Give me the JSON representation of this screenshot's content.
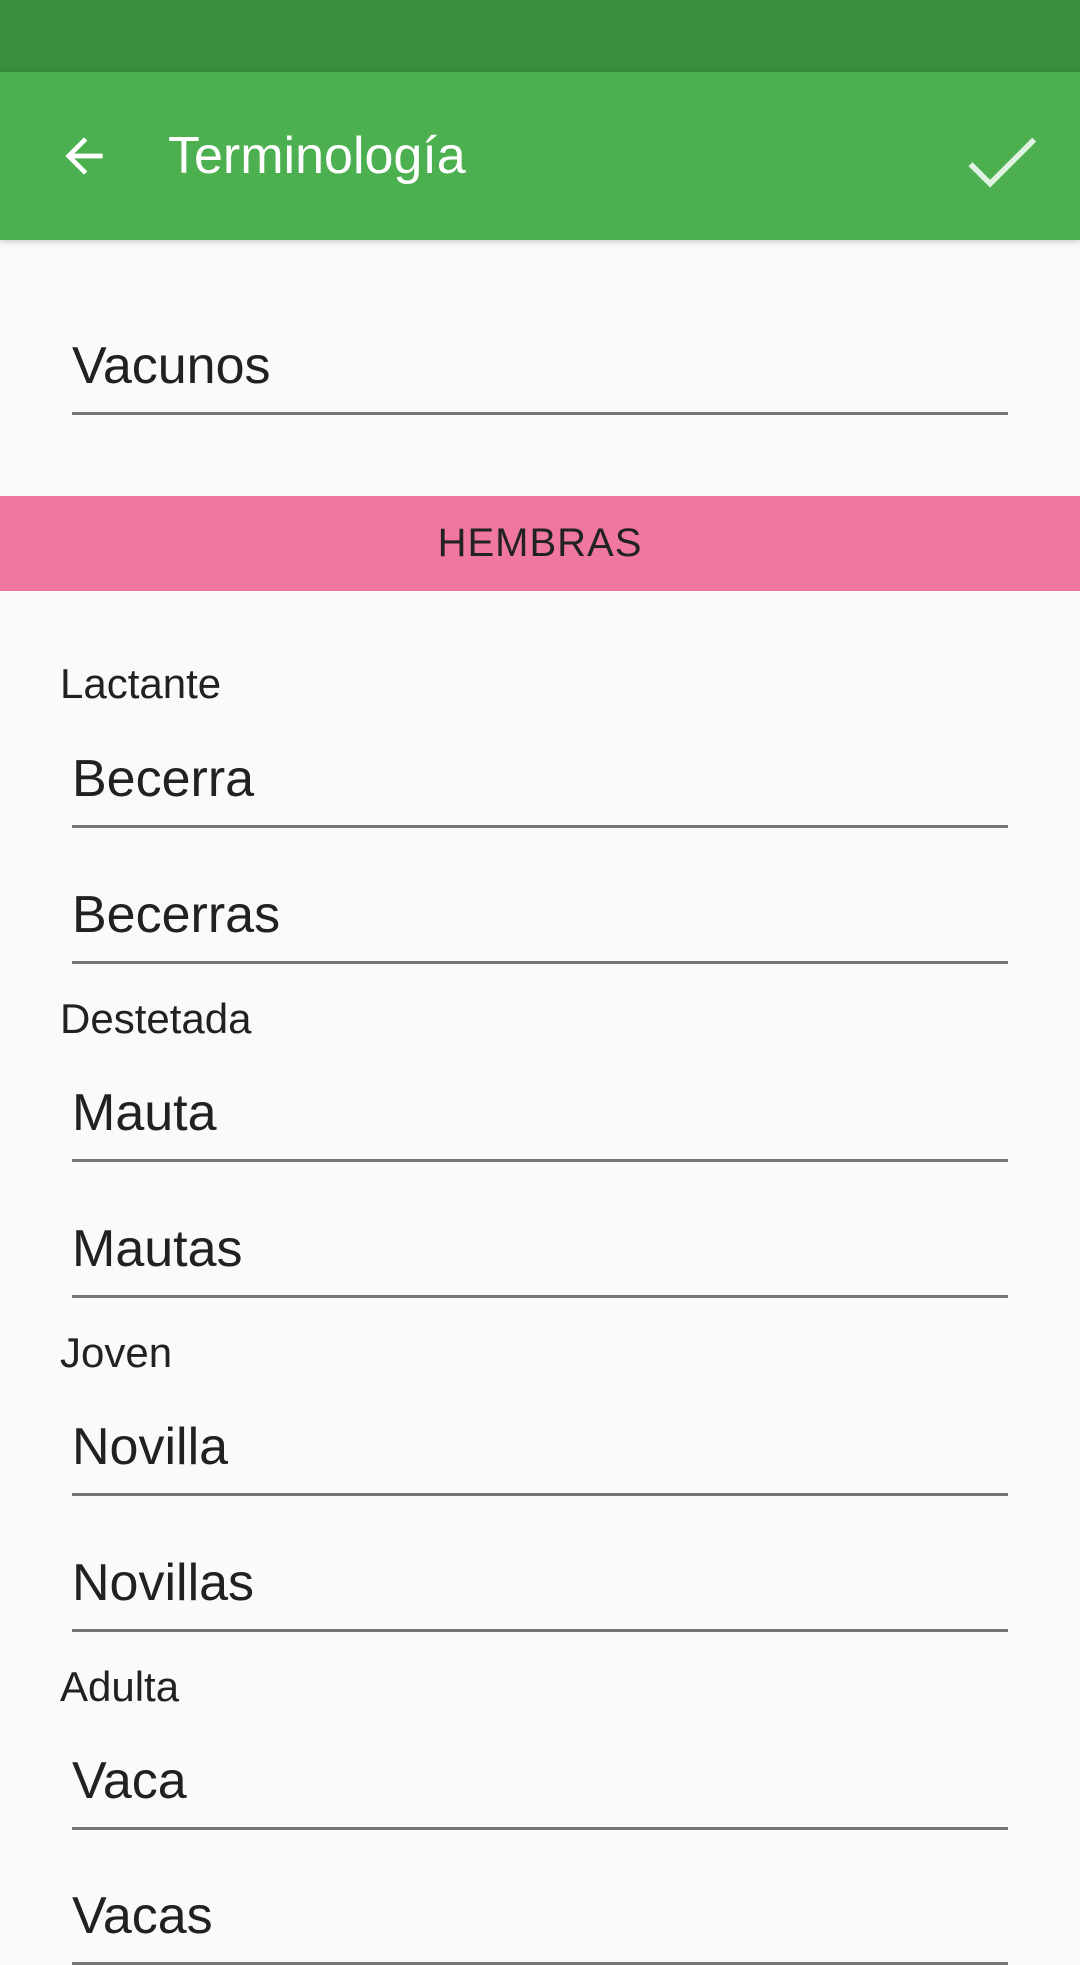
{
  "app_bar": {
    "title": "Terminología",
    "back_icon": "arrow-back-icon",
    "confirm_icon": "check-icon"
  },
  "species": {
    "value": "Vacunos"
  },
  "section": {
    "title": "HEMBRAS"
  },
  "groups": [
    {
      "label": "Lactante",
      "singular": "Becerra",
      "plural": "Becerras"
    },
    {
      "label": "Destetada",
      "singular": "Mauta",
      "plural": "Mautas"
    },
    {
      "label": "Joven",
      "singular": "Novilla",
      "plural": "Novillas"
    },
    {
      "label": "Adulta",
      "singular": "Vaca",
      "plural": "Vacas"
    }
  ],
  "colors": {
    "status_bar": "#388e3c",
    "app_bar": "#4caf50",
    "section_band": "#f078a0",
    "background": "#fafafa"
  }
}
